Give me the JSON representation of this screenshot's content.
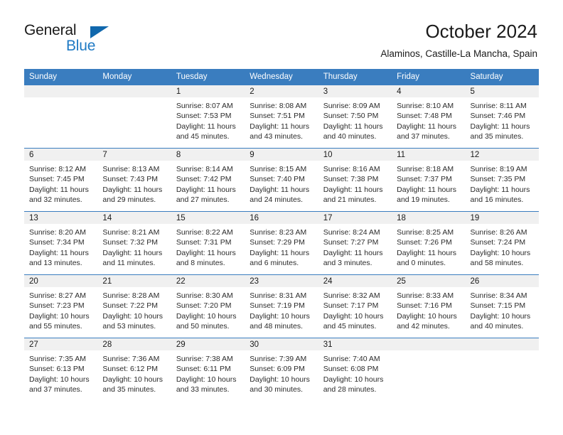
{
  "brand": {
    "line1": "General",
    "line2": "Blue",
    "triangle_color": "#1068ad"
  },
  "header": {
    "title": "October 2024",
    "subtitle": "Alaminos, Castille-La Mancha, Spain"
  },
  "theme": {
    "header_blue": "#3a7dbf",
    "daynum_gray": "#f0f0f0",
    "brand_blue": "#1f7ac4"
  },
  "weekdays": [
    "Sunday",
    "Monday",
    "Tuesday",
    "Wednesday",
    "Thursday",
    "Friday",
    "Saturday"
  ],
  "labels": {
    "sunrise_prefix": "Sunrise:",
    "sunset_prefix": "Sunset:",
    "daylight_prefix": "Daylight:"
  },
  "weeks": [
    [
      {
        "day": "",
        "empty": true
      },
      {
        "day": "",
        "empty": true
      },
      {
        "day": "1",
        "sunrise": "Sunrise: 8:07 AM",
        "sunset": "Sunset: 7:53 PM",
        "daylight1": "Daylight: 11 hours",
        "daylight2": "and 45 minutes."
      },
      {
        "day": "2",
        "sunrise": "Sunrise: 8:08 AM",
        "sunset": "Sunset: 7:51 PM",
        "daylight1": "Daylight: 11 hours",
        "daylight2": "and 43 minutes."
      },
      {
        "day": "3",
        "sunrise": "Sunrise: 8:09 AM",
        "sunset": "Sunset: 7:50 PM",
        "daylight1": "Daylight: 11 hours",
        "daylight2": "and 40 minutes."
      },
      {
        "day": "4",
        "sunrise": "Sunrise: 8:10 AM",
        "sunset": "Sunset: 7:48 PM",
        "daylight1": "Daylight: 11 hours",
        "daylight2": "and 37 minutes."
      },
      {
        "day": "5",
        "sunrise": "Sunrise: 8:11 AM",
        "sunset": "Sunset: 7:46 PM",
        "daylight1": "Daylight: 11 hours",
        "daylight2": "and 35 minutes."
      }
    ],
    [
      {
        "day": "6",
        "sunrise": "Sunrise: 8:12 AM",
        "sunset": "Sunset: 7:45 PM",
        "daylight1": "Daylight: 11 hours",
        "daylight2": "and 32 minutes."
      },
      {
        "day": "7",
        "sunrise": "Sunrise: 8:13 AM",
        "sunset": "Sunset: 7:43 PM",
        "daylight1": "Daylight: 11 hours",
        "daylight2": "and 29 minutes."
      },
      {
        "day": "8",
        "sunrise": "Sunrise: 8:14 AM",
        "sunset": "Sunset: 7:42 PM",
        "daylight1": "Daylight: 11 hours",
        "daylight2": "and 27 minutes."
      },
      {
        "day": "9",
        "sunrise": "Sunrise: 8:15 AM",
        "sunset": "Sunset: 7:40 PM",
        "daylight1": "Daylight: 11 hours",
        "daylight2": "and 24 minutes."
      },
      {
        "day": "10",
        "sunrise": "Sunrise: 8:16 AM",
        "sunset": "Sunset: 7:38 PM",
        "daylight1": "Daylight: 11 hours",
        "daylight2": "and 21 minutes."
      },
      {
        "day": "11",
        "sunrise": "Sunrise: 8:18 AM",
        "sunset": "Sunset: 7:37 PM",
        "daylight1": "Daylight: 11 hours",
        "daylight2": "and 19 minutes."
      },
      {
        "day": "12",
        "sunrise": "Sunrise: 8:19 AM",
        "sunset": "Sunset: 7:35 PM",
        "daylight1": "Daylight: 11 hours",
        "daylight2": "and 16 minutes."
      }
    ],
    [
      {
        "day": "13",
        "sunrise": "Sunrise: 8:20 AM",
        "sunset": "Sunset: 7:34 PM",
        "daylight1": "Daylight: 11 hours",
        "daylight2": "and 13 minutes."
      },
      {
        "day": "14",
        "sunrise": "Sunrise: 8:21 AM",
        "sunset": "Sunset: 7:32 PM",
        "daylight1": "Daylight: 11 hours",
        "daylight2": "and 11 minutes."
      },
      {
        "day": "15",
        "sunrise": "Sunrise: 8:22 AM",
        "sunset": "Sunset: 7:31 PM",
        "daylight1": "Daylight: 11 hours",
        "daylight2": "and 8 minutes."
      },
      {
        "day": "16",
        "sunrise": "Sunrise: 8:23 AM",
        "sunset": "Sunset: 7:29 PM",
        "daylight1": "Daylight: 11 hours",
        "daylight2": "and 6 minutes."
      },
      {
        "day": "17",
        "sunrise": "Sunrise: 8:24 AM",
        "sunset": "Sunset: 7:27 PM",
        "daylight1": "Daylight: 11 hours",
        "daylight2": "and 3 minutes."
      },
      {
        "day": "18",
        "sunrise": "Sunrise: 8:25 AM",
        "sunset": "Sunset: 7:26 PM",
        "daylight1": "Daylight: 11 hours",
        "daylight2": "and 0 minutes."
      },
      {
        "day": "19",
        "sunrise": "Sunrise: 8:26 AM",
        "sunset": "Sunset: 7:24 PM",
        "daylight1": "Daylight: 10 hours",
        "daylight2": "and 58 minutes."
      }
    ],
    [
      {
        "day": "20",
        "sunrise": "Sunrise: 8:27 AM",
        "sunset": "Sunset: 7:23 PM",
        "daylight1": "Daylight: 10 hours",
        "daylight2": "and 55 minutes."
      },
      {
        "day": "21",
        "sunrise": "Sunrise: 8:28 AM",
        "sunset": "Sunset: 7:22 PM",
        "daylight1": "Daylight: 10 hours",
        "daylight2": "and 53 minutes."
      },
      {
        "day": "22",
        "sunrise": "Sunrise: 8:30 AM",
        "sunset": "Sunset: 7:20 PM",
        "daylight1": "Daylight: 10 hours",
        "daylight2": "and 50 minutes."
      },
      {
        "day": "23",
        "sunrise": "Sunrise: 8:31 AM",
        "sunset": "Sunset: 7:19 PM",
        "daylight1": "Daylight: 10 hours",
        "daylight2": "and 48 minutes."
      },
      {
        "day": "24",
        "sunrise": "Sunrise: 8:32 AM",
        "sunset": "Sunset: 7:17 PM",
        "daylight1": "Daylight: 10 hours",
        "daylight2": "and 45 minutes."
      },
      {
        "day": "25",
        "sunrise": "Sunrise: 8:33 AM",
        "sunset": "Sunset: 7:16 PM",
        "daylight1": "Daylight: 10 hours",
        "daylight2": "and 42 minutes."
      },
      {
        "day": "26",
        "sunrise": "Sunrise: 8:34 AM",
        "sunset": "Sunset: 7:15 PM",
        "daylight1": "Daylight: 10 hours",
        "daylight2": "and 40 minutes."
      }
    ],
    [
      {
        "day": "27",
        "sunrise": "Sunrise: 7:35 AM",
        "sunset": "Sunset: 6:13 PM",
        "daylight1": "Daylight: 10 hours",
        "daylight2": "and 37 minutes."
      },
      {
        "day": "28",
        "sunrise": "Sunrise: 7:36 AM",
        "sunset": "Sunset: 6:12 PM",
        "daylight1": "Daylight: 10 hours",
        "daylight2": "and 35 minutes."
      },
      {
        "day": "29",
        "sunrise": "Sunrise: 7:38 AM",
        "sunset": "Sunset: 6:11 PM",
        "daylight1": "Daylight: 10 hours",
        "daylight2": "and 33 minutes."
      },
      {
        "day": "30",
        "sunrise": "Sunrise: 7:39 AM",
        "sunset": "Sunset: 6:09 PM",
        "daylight1": "Daylight: 10 hours",
        "daylight2": "and 30 minutes."
      },
      {
        "day": "31",
        "sunrise": "Sunrise: 7:40 AM",
        "sunset": "Sunset: 6:08 PM",
        "daylight1": "Daylight: 10 hours",
        "daylight2": "and 28 minutes."
      },
      {
        "day": "",
        "empty": true
      },
      {
        "day": "",
        "empty": true
      }
    ]
  ]
}
